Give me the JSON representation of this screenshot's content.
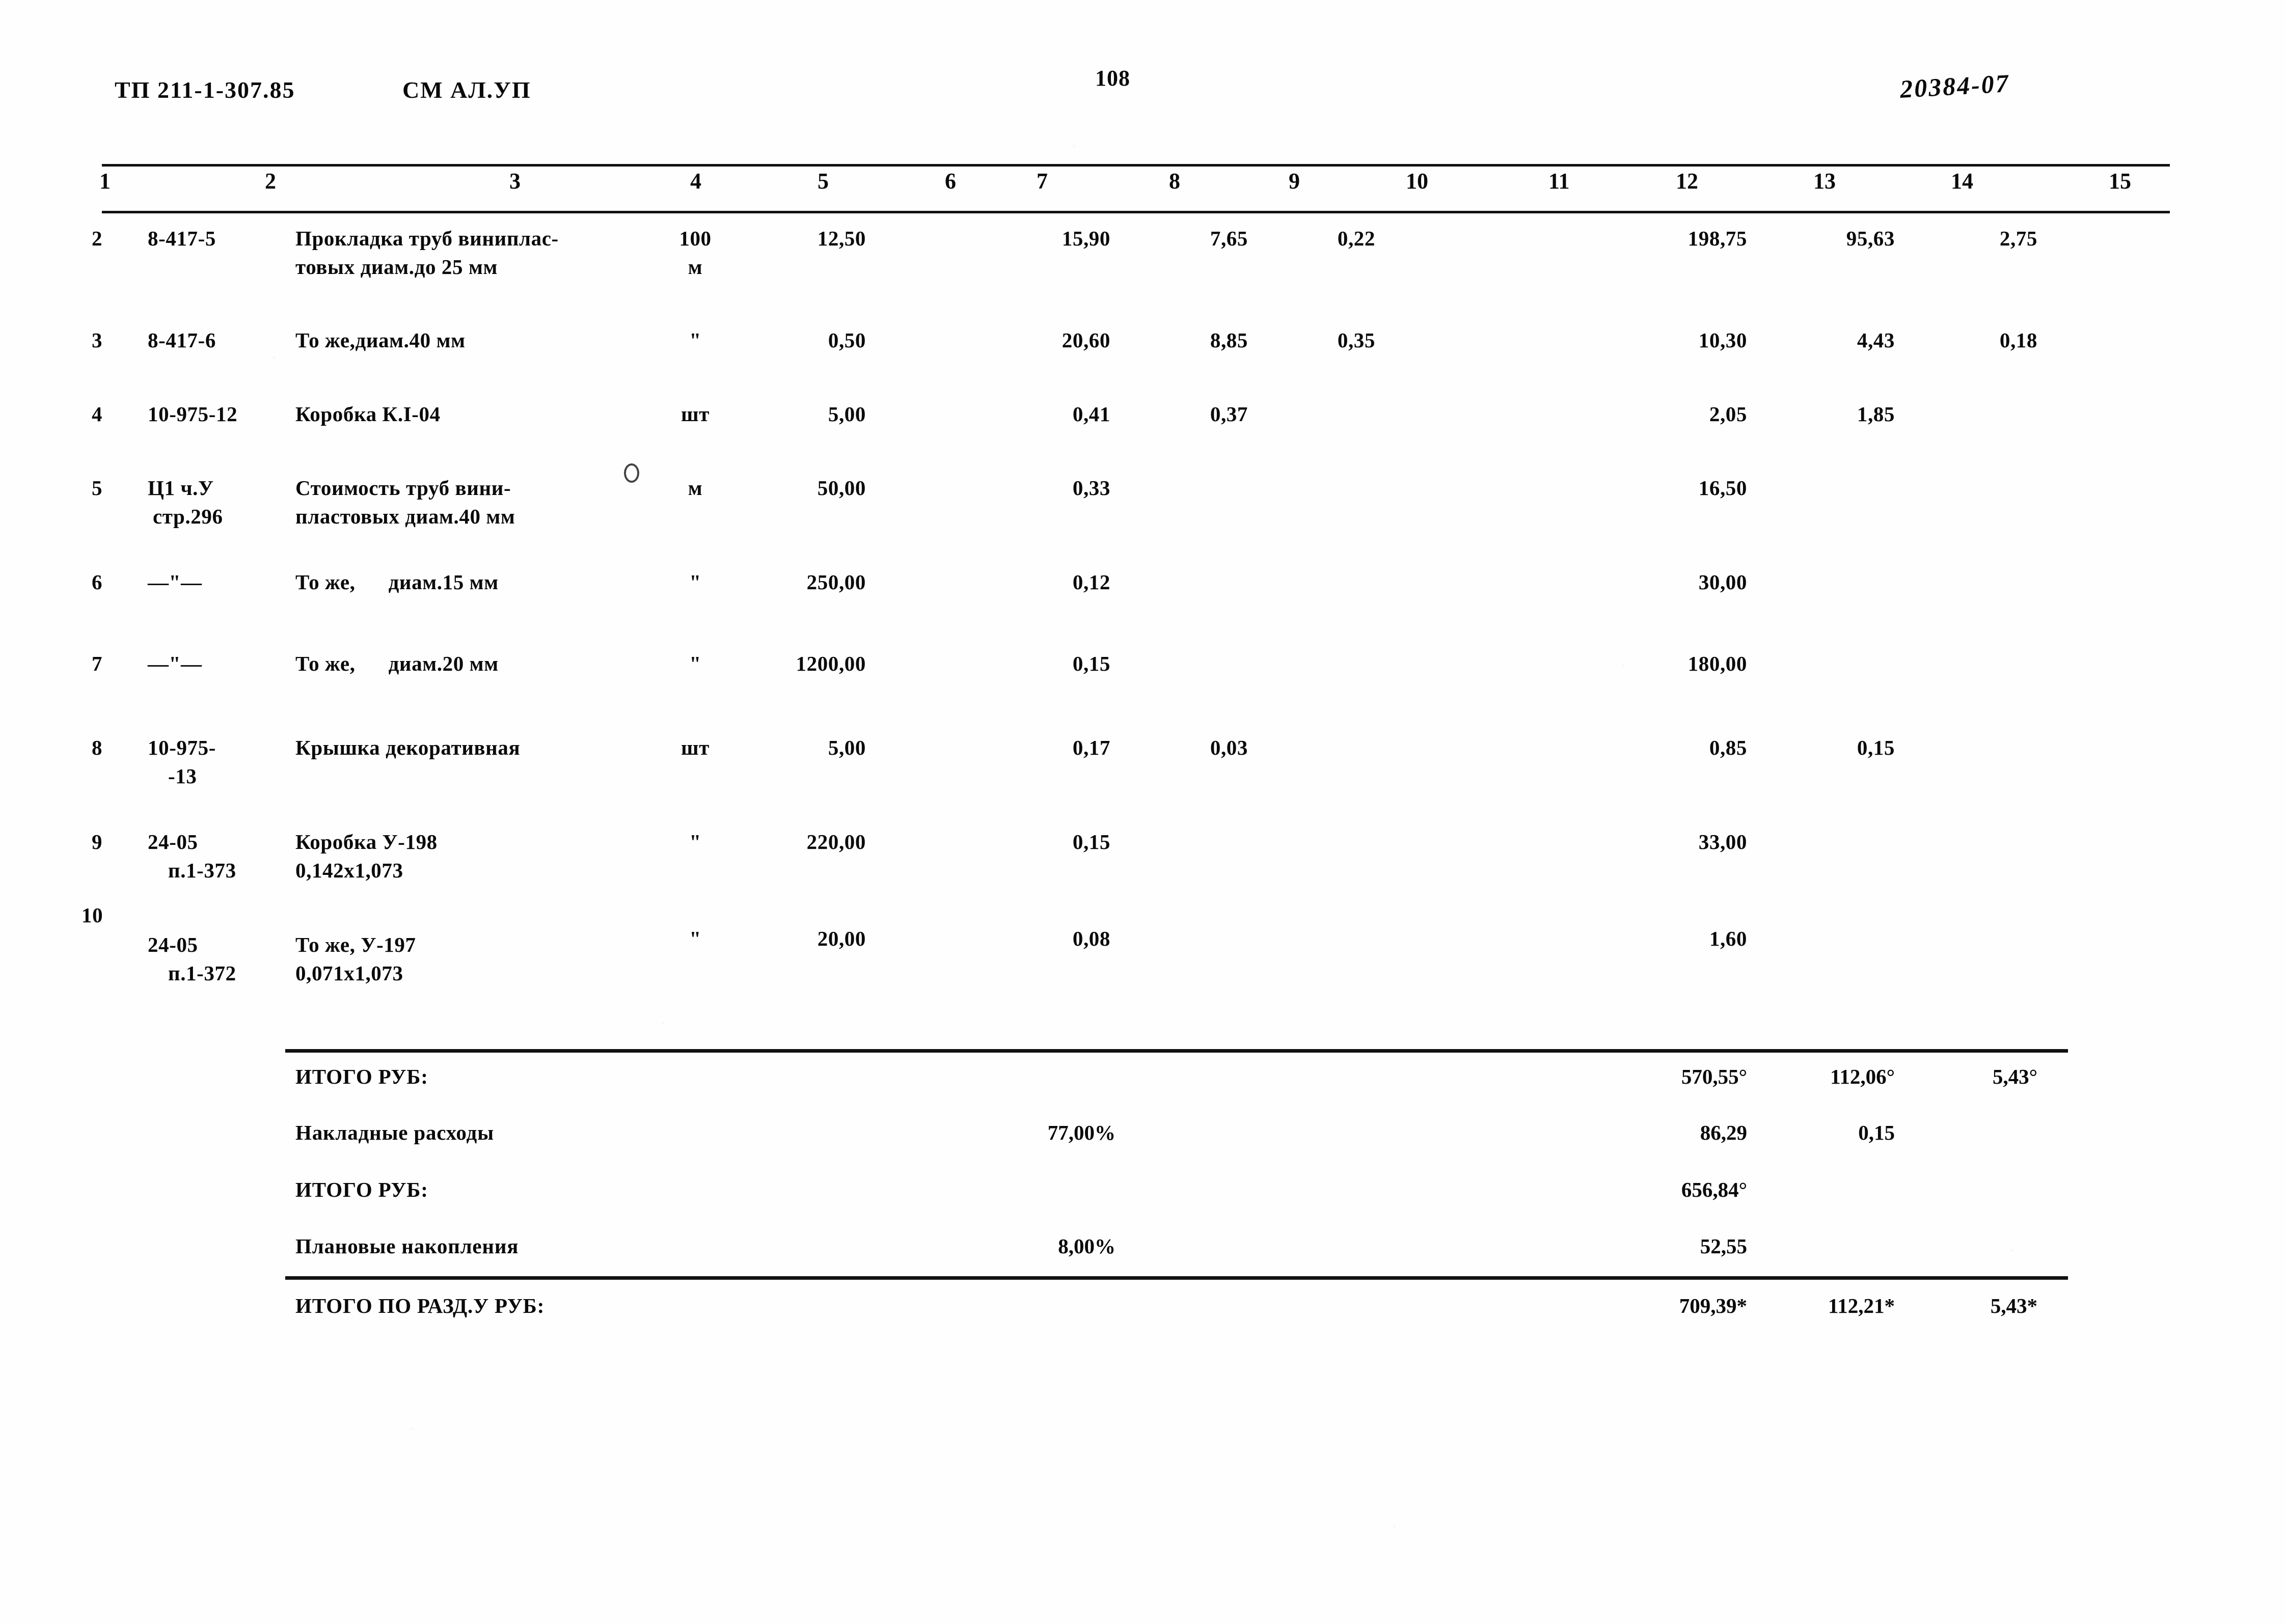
{
  "header": {
    "doc_code": "ТП 211-1-307.85",
    "sheet_code": "СМ АЛ.УП",
    "page_number": "108",
    "stamp": "20384-07"
  },
  "column_numbers": [
    "1",
    "2",
    "3",
    "4",
    "5",
    "6",
    "7",
    "8",
    "9",
    "10",
    "11",
    "12",
    "13",
    "14",
    "15"
  ],
  "rows": [
    {
      "no": "2",
      "code": "8-417-5",
      "desc_line1": "Прокладка труб виниплас-",
      "desc_line2": "товых диам.до 25 мм",
      "unit_line1": "100",
      "unit_line2": "м",
      "qty": "12,50",
      "c7": "15,90",
      "c8": "7,65",
      "c9": "0,22",
      "c12": "198,75",
      "c13": "95,63",
      "c14": "2,75"
    },
    {
      "no": "3",
      "code": "8-417-6",
      "desc_line1": "То же,диам.40 мм",
      "desc_line2": "",
      "unit_line1": "\"",
      "unit_line2": "",
      "qty": "0,50",
      "c7": "20,60",
      "c8": "8,85",
      "c9": "0,35",
      "c12": "10,30",
      "c13": "4,43",
      "c14": "0,18"
    },
    {
      "no": "4",
      "code": "10-975-12",
      "desc_line1": "Коробка К.I-04",
      "desc_line2": "",
      "unit_line1": "шт",
      "unit_line2": "",
      "qty": "5,00",
      "c7": "0,41",
      "c8": "0,37",
      "c9": "",
      "c12": "2,05",
      "c13": "1,85",
      "c14": ""
    },
    {
      "no": "5",
      "code": "Ц1 ч.У",
      "code_line2": "стр.296",
      "desc_line1": "Стоимость труб вини-",
      "desc_line2": "пластовых диам.40 мм",
      "unit_line1": "м",
      "unit_line2": "",
      "qty": "50,00",
      "c7": "0,33",
      "c8": "",
      "c9": "",
      "c12": "16,50",
      "c13": "",
      "c14": ""
    },
    {
      "no": "6",
      "code": "—\"—",
      "desc_line1": "То же,      диам.15 мм",
      "desc_line2": "",
      "unit_line1": "\"",
      "unit_line2": "",
      "qty": "250,00",
      "c7": "0,12",
      "c8": "",
      "c9": "",
      "c12": "30,00",
      "c13": "",
      "c14": ""
    },
    {
      "no": "7",
      "code": "—\"—",
      "desc_line1": "То же,      диам.20 мм",
      "desc_line2": "",
      "unit_line1": "\"",
      "unit_line2": "",
      "qty": "1200,00",
      "c7": "0,15",
      "c8": "",
      "c9": "",
      "c12": "180,00",
      "c13": "",
      "c14": ""
    },
    {
      "no": "8",
      "code": "10-975-",
      "code_line2": "-13",
      "desc_line1": "Крышка декоративная",
      "desc_line2": "",
      "unit_line1": "шт",
      "unit_line2": "",
      "qty": "5,00",
      "c7": "0,17",
      "c8": "0,03",
      "c9": "",
      "c12": "0,85",
      "c13": "0,15",
      "c14": ""
    },
    {
      "no": "9",
      "code": "24-05",
      "code_line2": "п.1-373",
      "desc_line1": "Коробка У-198",
      "desc_line2": "0,142х1,073",
      "unit_line1": "\"",
      "unit_line2": "",
      "qty": "220,00",
      "c7": "0,15",
      "c8": "",
      "c9": "",
      "c12": "33,00",
      "c13": "",
      "c14": ""
    },
    {
      "no": "10",
      "code": "24-05",
      "code_line2": "п.1-372",
      "desc_line1": "То же, У-197",
      "desc_line2": "0,071х1,073",
      "unit_line1": "\"",
      "unit_line2": "",
      "qty": "20,00",
      "c7": "0,08",
      "c8": "",
      "c9": "",
      "c12": "1,60",
      "c13": "",
      "c14": ""
    }
  ],
  "summary": [
    {
      "label": "ИТОГО РУБ:",
      "pct": "",
      "c12": "570,55°",
      "c13": "112,06°",
      "c14": "5,43°"
    },
    {
      "label": "Накладные расходы",
      "pct": "77,00%",
      "c12": "86,29",
      "c13": "0,15",
      "c14": ""
    },
    {
      "label": "ИТОГО РУБ:",
      "pct": "",
      "c12": "656,84°",
      "c13": "",
      "c14": ""
    },
    {
      "label": "Плановые накопления",
      "pct": "8,00%",
      "c12": "52,55",
      "c13": "",
      "c14": ""
    }
  ],
  "grand_total": {
    "label": "ИТОГО ПО РАЗД.У РУБ:",
    "c12": "709,39*",
    "c13": "112,21*",
    "c14": "5,43*"
  }
}
